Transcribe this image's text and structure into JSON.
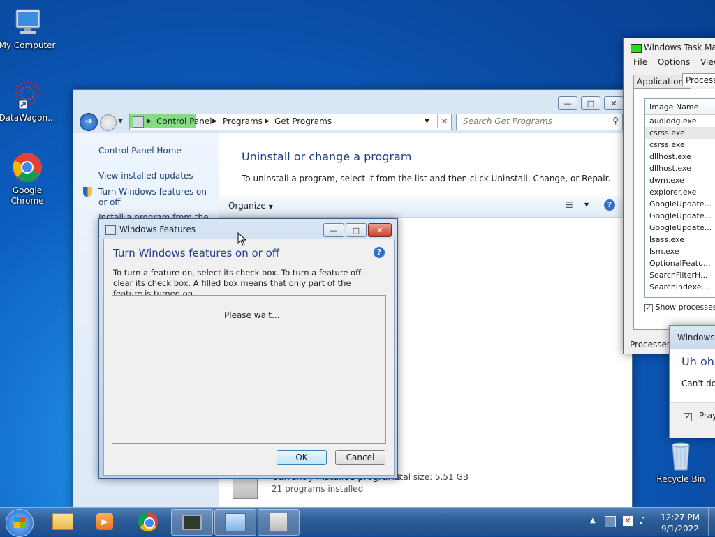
{
  "desktop": {
    "icons": [
      {
        "label": "My Computer"
      },
      {
        "label": "DataWagon..."
      },
      {
        "label": "Google Chrome"
      },
      {
        "label": "Recycle Bin"
      }
    ]
  },
  "control_panel": {
    "breadcrumbs": [
      "Control Panel",
      "Programs",
      "Get Programs"
    ],
    "search_placeholder": "Search Get Programs",
    "nav": {
      "home": "Control Panel Home",
      "updates": "View installed updates",
      "features": "Turn Windows features on or off",
      "install": "Install a program from the"
    },
    "heading": "Uninstall or change a program",
    "description": "To uninstall a program, select it from the list and then click Uninstall, Change, or Repair.",
    "organize_label": "Organize",
    "footer": {
      "title": "Currently installed programs",
      "total": "Total size: 5.51 GB",
      "count": "21 programs installed"
    }
  },
  "task_manager": {
    "title": "Windows Task Man",
    "menu": [
      "File",
      "Options",
      "View"
    ],
    "tabs": [
      "Applications",
      "Processe"
    ],
    "column_header": "Image Name",
    "processes": [
      "audiodg.exe",
      "csrss.exe",
      "csrss.exe",
      "dllhost.exe",
      "dllhost.exe",
      "dwm.exe",
      "explorer.exe",
      "GoogleUpdate...",
      "GoogleUpdate...",
      "GoogleUpdate...",
      "lsass.exe",
      "lsm.exe",
      "OptionalFeatu...",
      "SearchFilterH...",
      "SearchIndexe..."
    ],
    "show_all": "Show processes fr",
    "status": "Processes:"
  },
  "windows_features": {
    "title": "Windows Features",
    "heading": "Turn Windows features on or off",
    "description": "To turn a feature on, select its check box. To turn a feature off, clear its check box. A filled box means that only part of the feature is turned on.",
    "status": "Please wait...",
    "ok": "OK",
    "cancel": "Cancel"
  },
  "error_dialog": {
    "title": "Windows T",
    "heading": "Uh oh!",
    "text": "Can't do",
    "checkbox": "Pray"
  },
  "taskbar": {
    "time": "12:27 PM",
    "date": "9/1/2022"
  }
}
